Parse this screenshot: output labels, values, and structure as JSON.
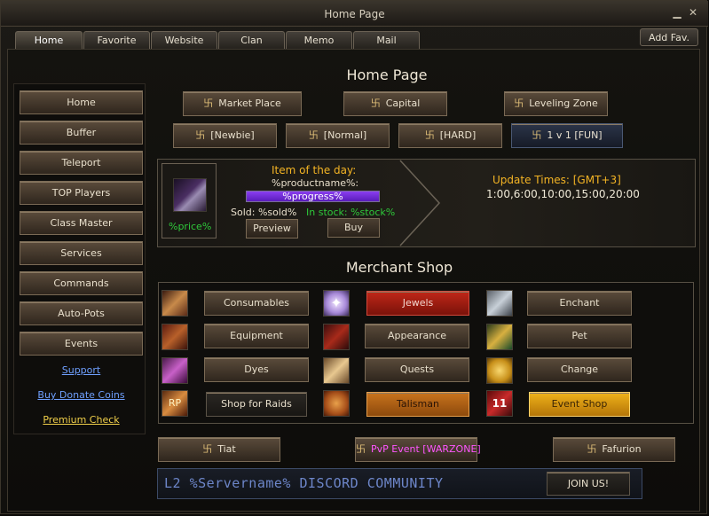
{
  "window": {
    "title": "Home Page"
  },
  "tabs": [
    "Home",
    "Favorite",
    "Website",
    "Clan",
    "Memo",
    "Mail"
  ],
  "add_fav": "Add Fav.",
  "sidebar": {
    "buttons": [
      "Home",
      "Buffer",
      "Teleport",
      "TOP Players",
      "Class Master",
      "Services",
      "Commands",
      "Auto-Pots",
      "Events"
    ],
    "links": {
      "support": "Support",
      "donate": "Buy Donate Coins",
      "premium": "Premium Check"
    }
  },
  "home": {
    "heading": "Home Page",
    "zones": [
      "Market Place",
      "Capital",
      "Leveling Zone"
    ],
    "modes": [
      "[Newbie]",
      "[Normal]",
      "[HARD]",
      "1 v 1 [FUN]"
    ]
  },
  "item_of_day": {
    "title": "Item of the day:",
    "product": "%productname%:",
    "progress": "%progress%",
    "sold_label": "Sold: %sold%",
    "stock_label": "In stock: %stock%",
    "price": "%price%",
    "preview": "Preview",
    "buy": "Buy"
  },
  "update_times": {
    "label": "Update Times: [GMT+3]",
    "times": "1:00,6:00,10:00,15:00,20:00"
  },
  "merchant": {
    "heading": "Merchant Shop",
    "col1": [
      "Consumables",
      "Equipment",
      "Dyes",
      "Shop for Raids"
    ],
    "col2": [
      "Jewels",
      "Appearance",
      "Quests",
      "Talisman"
    ],
    "col3": [
      "Enchant",
      "Pet",
      "Change",
      "Event Shop"
    ]
  },
  "bottom": {
    "tiat": "Tiat",
    "pvp": "PvP Event [WARZONE]",
    "fafurion": "Fafurion"
  },
  "discord": {
    "text": "L2 %Servername% DISCORD COMMUNITY",
    "join": "JOIN US!"
  },
  "colors": {
    "gold": "#f4b424",
    "green": "#2ec93a",
    "purple_bar": "#7a30e0",
    "link_blue": "#6fa0ff",
    "link_yellow": "#f1d04a"
  }
}
